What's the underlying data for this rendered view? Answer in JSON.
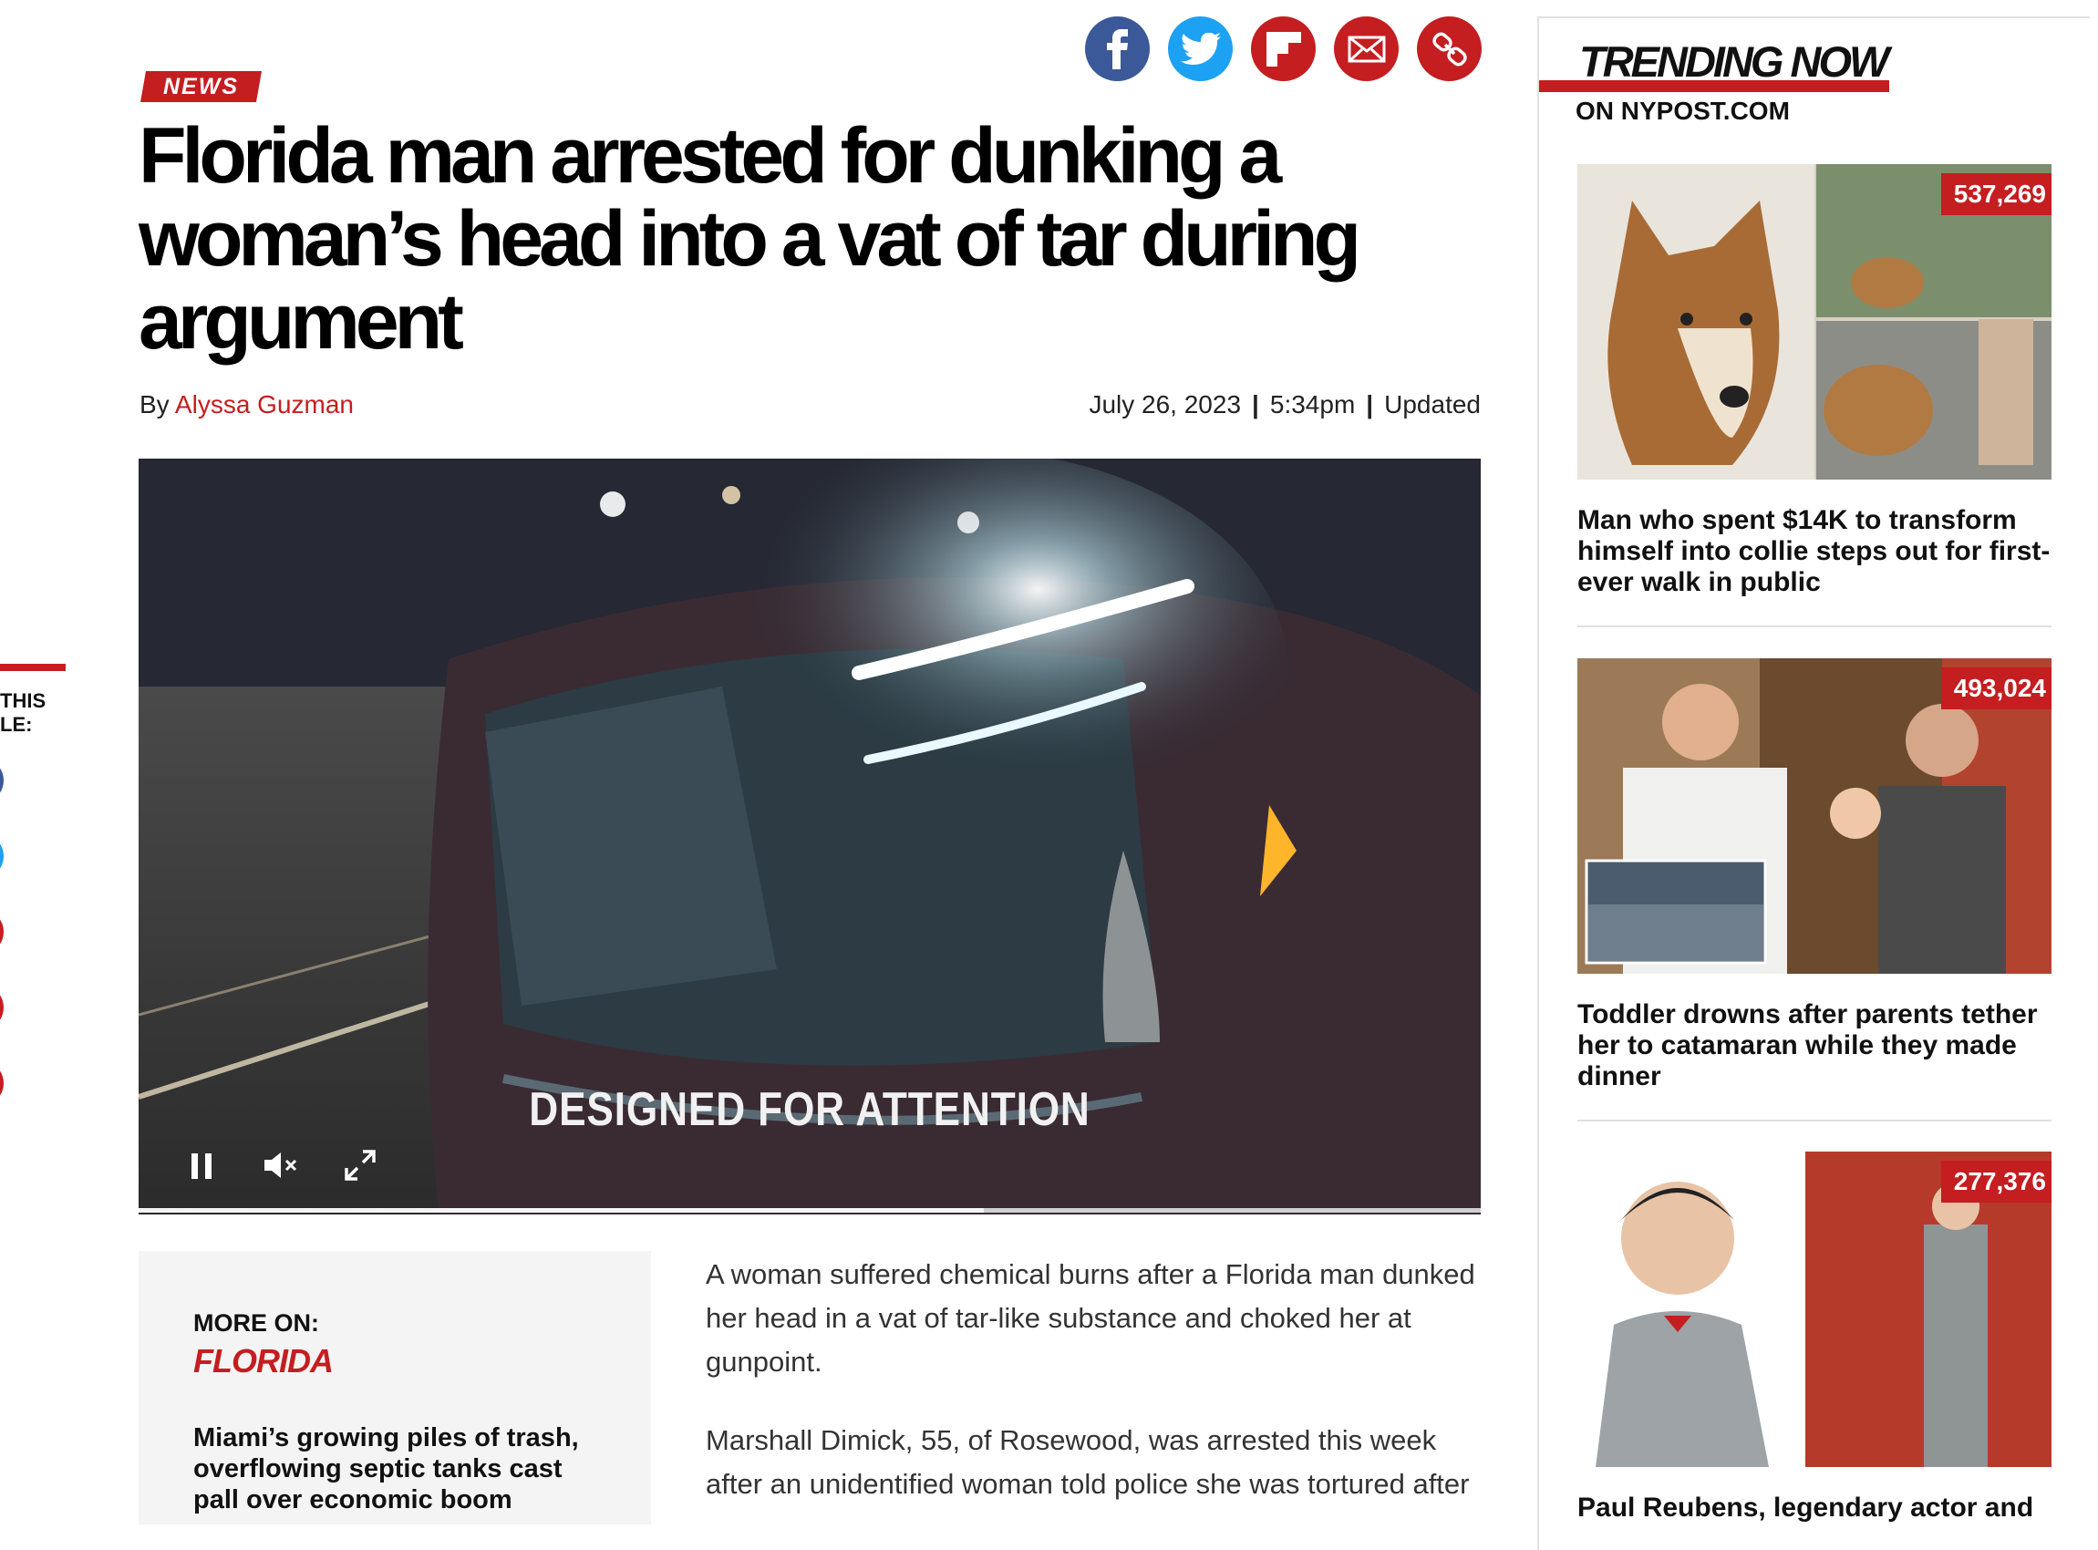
{
  "left_rail": {
    "share_label": "THIS\nLE:"
  },
  "social": [
    {
      "name": "facebook-icon",
      "color": "#3b5998"
    },
    {
      "name": "twitter-icon",
      "color": "#1da1f2"
    },
    {
      "name": "flipboard-icon",
      "color": "#c41e20"
    },
    {
      "name": "email-icon",
      "color": "#c41e20"
    },
    {
      "name": "link-icon",
      "color": "#c41e20"
    }
  ],
  "article": {
    "section_tag": "NEWS",
    "headline": "Florida man arrested for dunking a woman’s head into a vat of tar during argument",
    "by": "By",
    "author": "Alyssa Guzman",
    "date": "July 26, 2023",
    "sep1": "|",
    "time": "5:34pm",
    "sep2": "|",
    "updated": "Updated",
    "video": {
      "caption": "DESIGNED FOR ATTENTION",
      "progress": 0.63
    },
    "paragraph1": "A woman suffered chemical burns after a Florida man dunked her head in a vat of tar-like substance and choked her at gunpoint.",
    "paragraph2": "Marshall Dimick, 55, of Rosewood, was arrested this week after an unidentified woman told police she was tortured after"
  },
  "more_on": {
    "label": "MORE ON:",
    "topic": "FLORIDA",
    "related": "Miami’s growing piles of trash, overflowing septic tanks cast pall over economic boom"
  },
  "sidebar": {
    "title": "TRENDING NOW",
    "subtitle": "ON NYPOST.COM",
    "cards": [
      {
        "count": "537,269",
        "title": "Man who spent $14K to transform himself into collie steps out for first-ever walk in public"
      },
      {
        "count": "493,024",
        "title": "Toddler drowns after parents tether her to catamaran while they made dinner"
      },
      {
        "count": "277,376",
        "title": "Paul Reubens, legendary actor and"
      }
    ]
  },
  "colors": {
    "brand_red": "#c41e20",
    "facebook": "#3b5998",
    "twitter": "#1da1f2"
  }
}
